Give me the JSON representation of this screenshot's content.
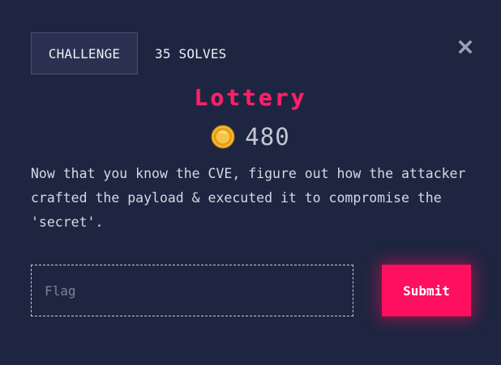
{
  "tabs": {
    "challenge_label": "CHALLENGE",
    "solves_label": "35 SOLVES"
  },
  "close_icon": "close-icon",
  "challenge": {
    "title": "Lottery",
    "points": "480",
    "points_icon": "coin-icon",
    "description": "Now that you know the CVE, figure out how the attacker\ncrafted the payload & executed it to compromise the\n'secret'."
  },
  "flag_input": {
    "placeholder": "Flag",
    "value": ""
  },
  "submit_label": "Submit",
  "colors": {
    "background": "#1e2540",
    "accent": "#ff0f5f",
    "title": "#ff1f6a",
    "coin": "#f5b731"
  }
}
